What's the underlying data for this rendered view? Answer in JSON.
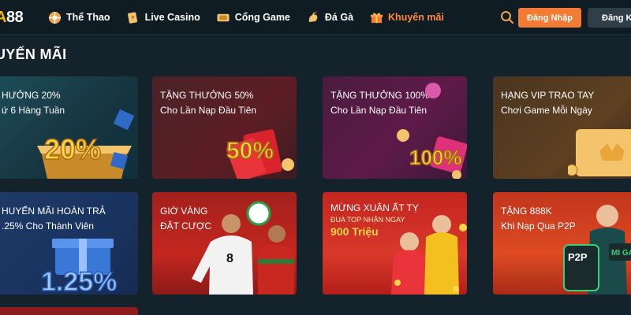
{
  "header": {
    "logo": {
      "prefix": "A",
      "number": "88"
    },
    "nav": [
      {
        "label": "Thể Thao",
        "icon": "soccer-ball-icon"
      },
      {
        "label": "Live Casino",
        "icon": "cards-icon"
      },
      {
        "label": "Cổng Game",
        "icon": "ticket-icon"
      },
      {
        "label": "Đá Gà",
        "icon": "rooster-icon"
      },
      {
        "label": "Khuyến mãi",
        "icon": "gift-icon",
        "active": true
      }
    ],
    "login_label": "Đăng Nhập",
    "register_label": "Đăng Ký"
  },
  "page_title": "UYẾN MÃI",
  "cards": [
    {
      "line1": "HƯỞNG 20%",
      "line2": "ứ 6 Hàng Tuần",
      "art": "20%"
    },
    {
      "line1": "TẶNG THƯỞNG 50%",
      "line2": "Cho Lần Nạp Đầu Tiên",
      "art": "50%"
    },
    {
      "line1": "TẶNG THƯỞNG 100%",
      "line2": "Cho Lần Nạp Đầu Tiên",
      "art": "100%"
    },
    {
      "line1": "HẠNG VIP TRAO TAY",
      "line2": "Chơi Game Mỗi Ngày"
    },
    {
      "line1": "HUYẾN MÃI HOÀN TRẢ",
      "line2": ".25% Cho Thành Viên",
      "art": "1.25%"
    },
    {
      "line1": "GIỜ VÀNG",
      "line2": "ĐẶT CƯỢC",
      "jersey": "8"
    },
    {
      "line1": "MỪNG XUÂN ẤT TỴ",
      "line2": "ĐUA TOP NHẬN NGAY",
      "line3": "900 Triệu"
    },
    {
      "line1": "TẶNG 888K",
      "line2": "Khi Nạp Qua P2P",
      "art": "P2P",
      "art2": "MI GAM"
    }
  ],
  "colors": {
    "accent": "#f47b33",
    "background": "#13222b",
    "active_nav": "#ff8a3a"
  }
}
